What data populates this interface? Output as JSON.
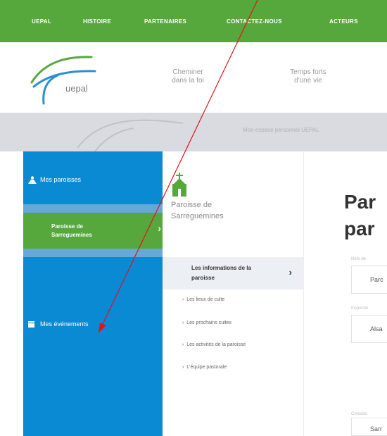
{
  "topnav": {
    "items": [
      "UEPAL",
      "HISTOIRE",
      "PARTENAIRES",
      "CONTACTEZ-NOUS",
      "ACTEURS"
    ]
  },
  "header": {
    "logo_text": "uepal",
    "menu": [
      "Cheminer\ndans la foi",
      "Temps forts\nd'une vie"
    ]
  },
  "banner": {
    "text": "Mon espace personnel UEPAL"
  },
  "sidebar": {
    "items": [
      {
        "label": "Mes paroisses",
        "icon": "people-icon"
      },
      {
        "label": "Mes événements",
        "icon": "calendar-icon"
      }
    ],
    "active": {
      "label": "Paroisse de\nSarreguemines"
    }
  },
  "middle": {
    "parish_name": "Paroisse de\nSarreguemines",
    "active_item": "Les informations de la\nparoisse",
    "sub_items": [
      "Les lieux de culte",
      "Les prochains cultes",
      "Les activités de la paroisse",
      "L'équipe pastorale"
    ]
  },
  "main": {
    "title": "Par\npar",
    "fields": [
      {
        "label": "Nom de",
        "value": "Parc"
      },
      {
        "label": "Inspectio",
        "value": "Alsa"
      },
      {
        "label": "Consisto",
        "value": "Sarr"
      }
    ]
  },
  "colors": {
    "green": "#56a83c",
    "blue": "#098ad3",
    "annotation": "#e0141e"
  }
}
